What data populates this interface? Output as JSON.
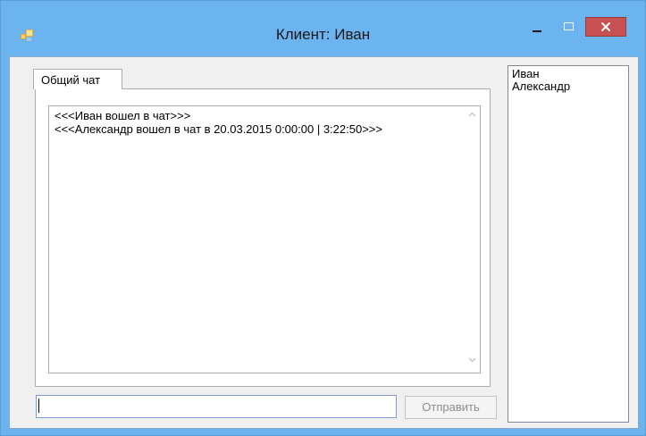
{
  "window": {
    "title": "Клиент: Иван",
    "icon": "app-icon",
    "controls": {
      "minimize": "minimize-icon",
      "maximize": "maximize-icon",
      "close": "close-icon"
    },
    "colors": {
      "frame": "#6cb4f0",
      "close": "#c75050",
      "client": "#f0f0f0"
    }
  },
  "tabs": [
    {
      "label": "Общий чат",
      "selected": true
    }
  ],
  "chat": {
    "messages": [
      "<<<Иван вошел в чат>>>",
      "<<<Александр вошел в чат в 20.03.2015 0:00:00 | 3:22:50>>>"
    ]
  },
  "input": {
    "value": "",
    "placeholder": ""
  },
  "send_button": {
    "label": "Отправить",
    "enabled": false
  },
  "users": [
    "Иван",
    "Александр"
  ]
}
